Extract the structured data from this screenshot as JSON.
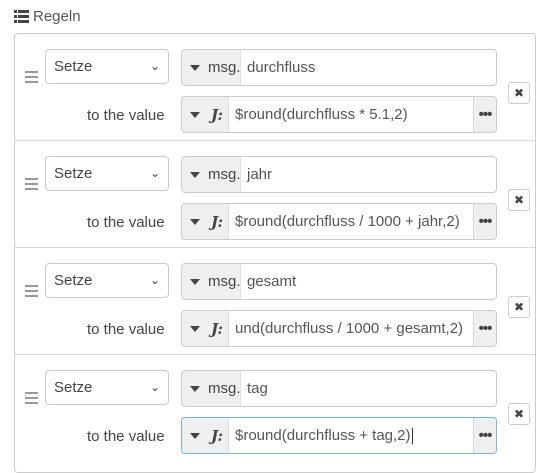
{
  "header": {
    "title": "Regeln",
    "icon": "list-icon"
  },
  "rules": [
    {
      "action": "Setze",
      "target_type": "msg.",
      "target": "durchfluss",
      "to_label": "to the value",
      "value_type": "J:",
      "value": "$round(durchfluss * 5.1,2)"
    },
    {
      "action": "Setze",
      "target_type": "msg.",
      "target": "jahr",
      "to_label": "to the value",
      "value_type": "J:",
      "value": "$round(durchfluss  / 1000 + jahr,2)"
    },
    {
      "action": "Setze",
      "target_type": "msg.",
      "target": "gesamt",
      "to_label": "to the value",
      "value_type": "J:",
      "value": "und(durchfluss  / 1000 + gesamt,2)"
    },
    {
      "action": "Setze",
      "target_type": "msg.",
      "target": "tag",
      "to_label": "to the value",
      "value_type": "J:",
      "value": "$round(durchfluss  + tag,2)"
    }
  ],
  "icons": {
    "handle": "drag-handle-icon",
    "delete": "close-icon",
    "chevron": "chevron-down-icon",
    "caret": "caret-down-icon",
    "more": "ellipsis-icon"
  }
}
